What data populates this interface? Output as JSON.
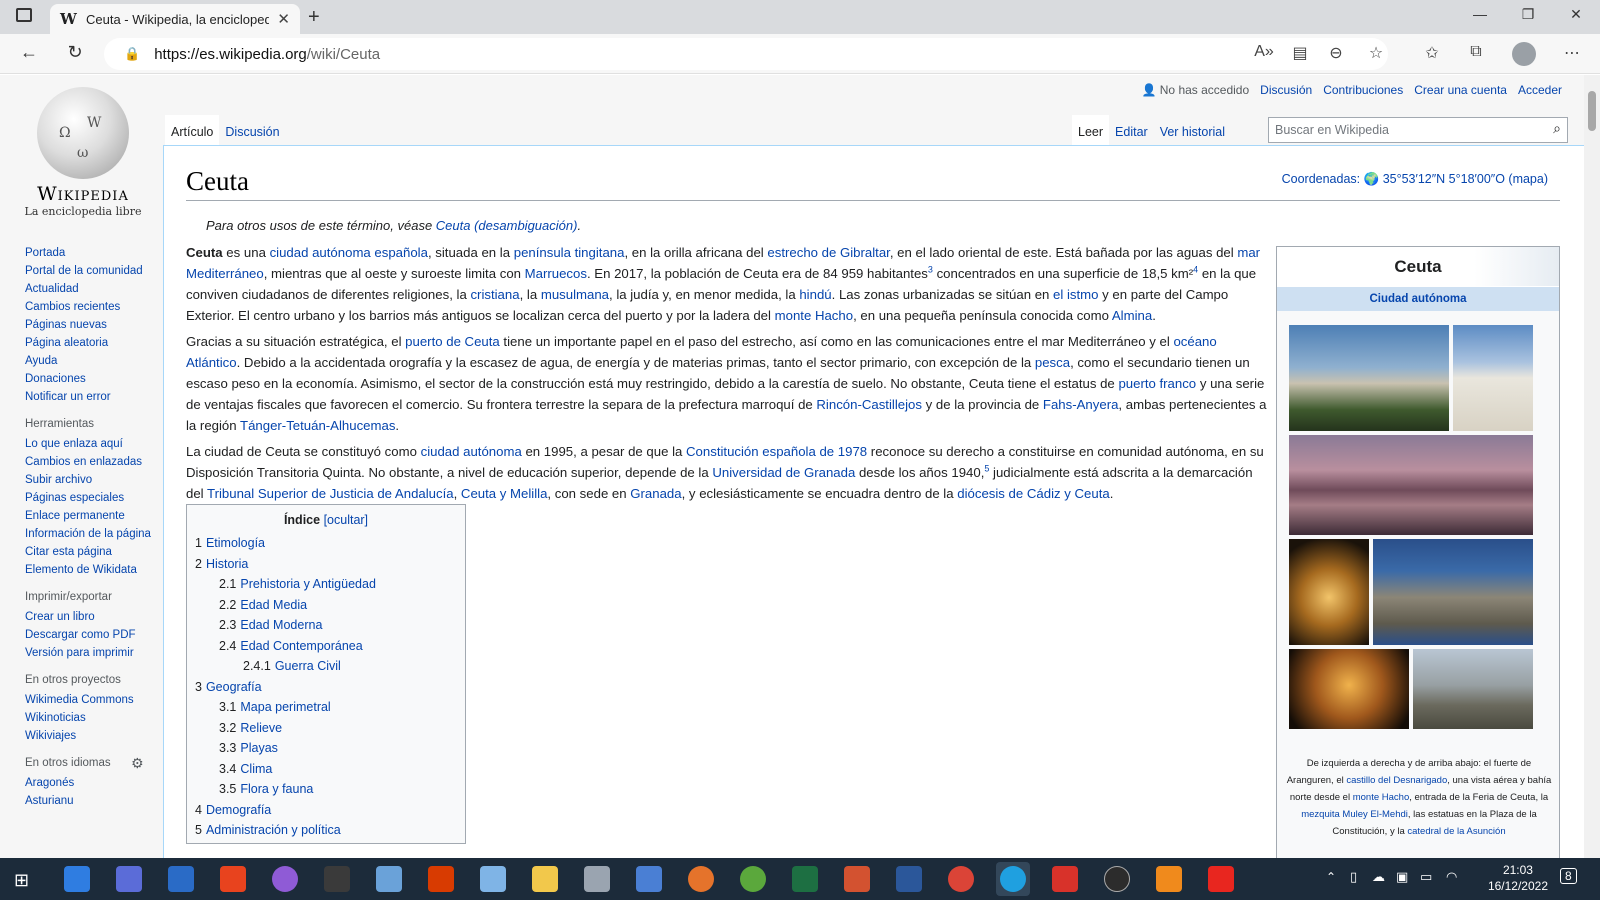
{
  "browser": {
    "tab_title": "Ceuta - Wikipedia, la enciclopedi",
    "tab_favicon": "W",
    "url_host": "https://es.wikipedia.org",
    "url_path": "/wiki/Ceuta"
  },
  "wiki": {
    "wordmark": "Wikipedia",
    "tagline": "La enciclopedia libre",
    "personal": {
      "user": "No has accedido",
      "discussion": "Discusión",
      "contributions": "Contribuciones",
      "create": "Crear una cuenta",
      "login": "Acceder"
    },
    "tabs": {
      "article": "Artículo",
      "talk": "Discusión",
      "read": "Leer",
      "edit": "Editar",
      "history": "Ver historial"
    },
    "search_placeholder": "Buscar en Wikipedia",
    "sidebar": {
      "main": [
        "Portada",
        "Portal de la comunidad",
        "Actualidad",
        "Cambios recientes",
        "Páginas nuevas",
        "Página aleatoria",
        "Ayuda",
        "Donaciones",
        "Notificar un error"
      ],
      "tools_head": "Herramientas",
      "tools": [
        "Lo que enlaza aquí",
        "Cambios en enlazadas",
        "Subir archivo",
        "Páginas especiales",
        "Enlace permanente",
        "Información de la página",
        "Citar esta página",
        "Elemento de Wikidata"
      ],
      "print_head": "Imprimir/exportar",
      "print": [
        "Crear un libro",
        "Descargar como PDF",
        "Versión para imprimir"
      ],
      "projects_head": "En otros proyectos",
      "projects": [
        "Wikimedia Commons",
        "Wikinoticias",
        "Wikiviajes"
      ],
      "langs_head": "En otros idiomas",
      "langs": [
        "Aragonés",
        "Asturianu"
      ]
    },
    "title": "Ceuta",
    "coords_label": "Coordenadas:",
    "coords_value": "35°53′12″N 5°18′00″O",
    "coords_map": "(mapa)",
    "hatnote_text": "Para otros usos de este término, véase ",
    "hatnote_link": "Ceuta (desambiguación)",
    "toc": {
      "title": "Índice",
      "toggle": "[ocultar]",
      "items": [
        {
          "num": "1",
          "text": "Etimología",
          "level": 1
        },
        {
          "num": "2",
          "text": "Historia",
          "level": 1
        },
        {
          "num": "2.1",
          "text": "Prehistoria y Antigüedad",
          "level": 2
        },
        {
          "num": "2.2",
          "text": "Edad Media",
          "level": 2
        },
        {
          "num": "2.3",
          "text": "Edad Moderna",
          "level": 2
        },
        {
          "num": "2.4",
          "text": "Edad Contemporánea",
          "level": 2
        },
        {
          "num": "2.4.1",
          "text": "Guerra Civil",
          "level": 3
        },
        {
          "num": "3",
          "text": "Geografía",
          "level": 1
        },
        {
          "num": "3.1",
          "text": "Mapa perimetral",
          "level": 2
        },
        {
          "num": "3.2",
          "text": "Relieve",
          "level": 2
        },
        {
          "num": "3.3",
          "text": "Playas",
          "level": 2
        },
        {
          "num": "3.4",
          "text": "Clima",
          "level": 2
        },
        {
          "num": "3.5",
          "text": "Flora y fauna",
          "level": 2
        },
        {
          "num": "4",
          "text": "Demografía",
          "level": 1
        },
        {
          "num": "5",
          "text": "Administración y política",
          "level": 1
        }
      ]
    },
    "infobox": {
      "title": "Ceuta",
      "subtitle": "Ciudad autónoma",
      "caption": [
        {
          "t": "De izquierda a derecha y de arriba abajo: el fuerte de Aranguren, el "
        },
        {
          "l": "castillo del Desnarigado"
        },
        {
          "t": ", una vista aérea y bahía norte desde el "
        },
        {
          "l": "monte Hacho"
        },
        {
          "t": ", entrada de la Feria de Ceuta, la "
        },
        {
          "l": "mezquita Muley El-Mehdi"
        },
        {
          "t": ", las estatuas en la Plaza de la Constitución, y la "
        },
        {
          "l": "catedral de la Asunción"
        }
      ]
    },
    "paragraphs": [
      [
        {
          "b": "Ceuta"
        },
        {
          "t": " es una "
        },
        {
          "l": "ciudad autónoma española"
        },
        {
          "t": ", situada en la "
        },
        {
          "l": "península tingitana"
        },
        {
          "t": ", en la orilla africana del "
        },
        {
          "l": "estrecho de Gibraltar"
        },
        {
          "t": ", en el lado oriental de este. Está bañada por las aguas del "
        },
        {
          "l": "mar Mediterráneo"
        },
        {
          "t": ", mientras que al oeste y suroeste limita con "
        },
        {
          "l": "Marruecos"
        },
        {
          "t": ". En 2017, la población de Ceuta era de 84 959 habitantes"
        },
        {
          "s": "3"
        },
        {
          "t": " concentrados en una superficie de 18,5 km²"
        },
        {
          "s": "4"
        },
        {
          "t": " en la que conviven ciudadanos de diferentes religiones, la "
        },
        {
          "l": "cristiana"
        },
        {
          "t": ", la "
        },
        {
          "l": "musulmana"
        },
        {
          "t": ", la judía y, en menor medida, la "
        },
        {
          "l": "hindú"
        },
        {
          "t": ". Las zonas urbanizadas se sitúan en "
        },
        {
          "l": "el istmo"
        },
        {
          "t": " y en parte del Campo Exterior. El centro urbano y los barrios más antiguos se localizan cerca del puerto y por la ladera del "
        },
        {
          "l": "monte Hacho"
        },
        {
          "t": ", en una pequeña península conocida como "
        },
        {
          "l": "Almina"
        },
        {
          "t": "."
        }
      ],
      [
        {
          "t": "Gracias a su situación estratégica, el "
        },
        {
          "l": "puerto de Ceuta"
        },
        {
          "t": " tiene un importante papel en el paso del estrecho, así como en las comunicaciones entre el mar Mediterráneo y el "
        },
        {
          "l": "océano Atlántico"
        },
        {
          "t": ". Debido a la accidentada orografía y la escasez de agua, de energía y de materias primas, tanto el sector primario, con excepción de la "
        },
        {
          "l": "pesca"
        },
        {
          "t": ", como el secundario tienen un escaso peso en la economía. Asimismo, el sector de la construcción está muy restringido, debido a la carestía de suelo. No obstante, Ceuta tiene el estatus de "
        },
        {
          "l": "puerto franco"
        },
        {
          "t": " y una serie de ventajas fiscales que favorecen el comercio. Su frontera terrestre la separa de la prefectura marroquí de "
        },
        {
          "l": "Rincón-Castillejos"
        },
        {
          "t": " y de la provincia de "
        },
        {
          "l": "Fahs-Anyera"
        },
        {
          "t": ", ambas pertenecientes a la región "
        },
        {
          "l": "Tánger-Tetuán-Alhucemas"
        },
        {
          "t": "."
        }
      ],
      [
        {
          "t": "La ciudad de Ceuta se constituyó como "
        },
        {
          "l": "ciudad autónoma"
        },
        {
          "t": " en 1995, a pesar de que la "
        },
        {
          "l": "Constitución española de 1978"
        },
        {
          "t": " reconoce su derecho a constituirse en comunidad autónoma, en su Disposición Transitoria Quinta. No obstante, a nivel de educación superior, depende de la "
        },
        {
          "l": "Universidad de Granada"
        },
        {
          "t": " desde los años 1940,"
        },
        {
          "s": "5"
        },
        {
          "t": " judicialmente está adscrita a la demarcación del "
        },
        {
          "l": "Tribunal Superior de Justicia de Andalucía"
        },
        {
          "t": ", "
        },
        {
          "l": "Ceuta y Melilla"
        },
        {
          "t": ", con sede en "
        },
        {
          "l": "Granada"
        },
        {
          "t": ", y eclesiásticamente se encuadra dentro de la "
        },
        {
          "l": "diócesis de Cádiz y Ceuta"
        },
        {
          "t": "."
        }
      ]
    ]
  },
  "taskbar": {
    "time": "21:03",
    "date": "16/12/2022",
    "notifications": "8"
  }
}
